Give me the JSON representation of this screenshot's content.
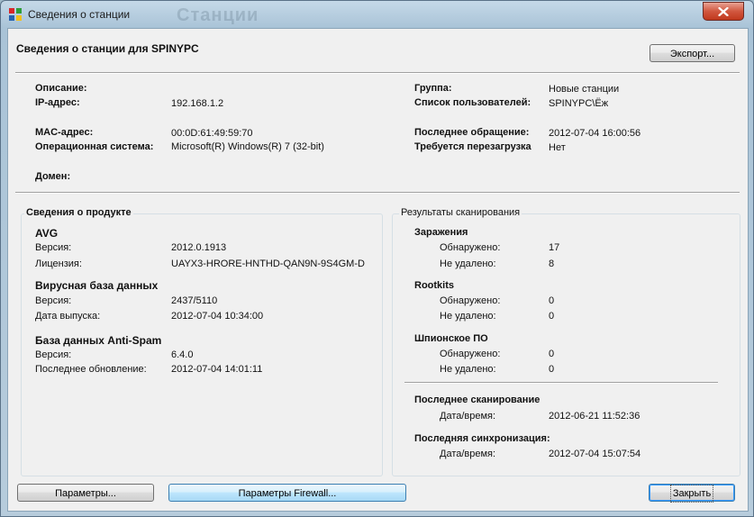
{
  "window": {
    "title": "Сведения о станции",
    "ghost_text": "Станции"
  },
  "header": {
    "title": "Сведения о станции для SPINYPC",
    "export_button": "Экспорт..."
  },
  "station": {
    "description_label": "Описание:",
    "ip_label": "IP-адрес:",
    "ip_value": "192.168.1.2",
    "mac_label": "MAC-адрес:",
    "mac_value": "00:0D:61:49:59:70",
    "os_label": "Операционная система:",
    "os_value": "Microsoft(R) Windows(R) 7 (32-bit)",
    "domain_label": "Домен:",
    "group_label": "Группа:",
    "group_value": "Новые станции",
    "users_label": "Список пользователей:",
    "users_value": "SPINYPC\\Ёж",
    "last_contact_label": "Последнее обращение:",
    "last_contact_value": "2012-07-04 16:00:56",
    "reboot_label": "Требуется перезагрузка",
    "reboot_value": "Нет"
  },
  "product": {
    "legend": "Сведения о продукте",
    "avg_title": "AVG",
    "avg_version_label": "Версия:",
    "avg_version_value": "2012.0.1913",
    "avg_license_label": "Лицензия:",
    "avg_license_value": "UAYX3-HRORE-HNTHD-QAN9N-9S4GM-D",
    "virus_db_title": "Вирусная база данных",
    "virus_db_version_label": "Версия:",
    "virus_db_version_value": "2437/5110",
    "virus_db_date_label": "Дата выпуска:",
    "virus_db_date_value": "2012-07-04 10:34:00",
    "antispam_title": "База данных Anti-Spam",
    "antispam_version_label": "Версия:",
    "antispam_version_value": "6.4.0",
    "antispam_update_label": "Последнее обновление:",
    "antispam_update_value": "2012-07-04 14:01:11"
  },
  "scan": {
    "legend": "Результаты сканирования",
    "infections_title": "Заражения",
    "infections_found_label": "Обнаружено:",
    "infections_found_value": "17",
    "infections_notremoved_label": "Не удалено:",
    "infections_notremoved_value": "8",
    "rootkits_title": "Rootkits",
    "rootkits_found_label": "Обнаружено:",
    "rootkits_found_value": "0",
    "rootkits_notremoved_label": "Не удалено:",
    "rootkits_notremoved_value": "0",
    "spyware_title": "Шпионское ПО",
    "spyware_found_label": "Обнаружено:",
    "spyware_found_value": "0",
    "spyware_notremoved_label": "Не удалено:",
    "spyware_notremoved_value": "0",
    "last_scan_title": "Последнее сканирование",
    "last_scan_label": "Дата/время:",
    "last_scan_value": "2012-06-21 11:52:36",
    "last_sync_title": "Последняя синхронизация:",
    "last_sync_label": "Дата/время:",
    "last_sync_value": "2012-07-04 15:07:54"
  },
  "footer": {
    "params_button": "Параметры...",
    "firewall_button": "Параметры Firewall...",
    "close_button": "Закрыть"
  },
  "colors": {
    "close_red": "#c0381d",
    "avg_red": "#d8262a",
    "avg_green": "#2f9e3a",
    "avg_blue": "#2563b0",
    "avg_yellow": "#f2c01b"
  },
  "icons": {
    "app": "avg-logo-icon",
    "close": "close-icon"
  }
}
